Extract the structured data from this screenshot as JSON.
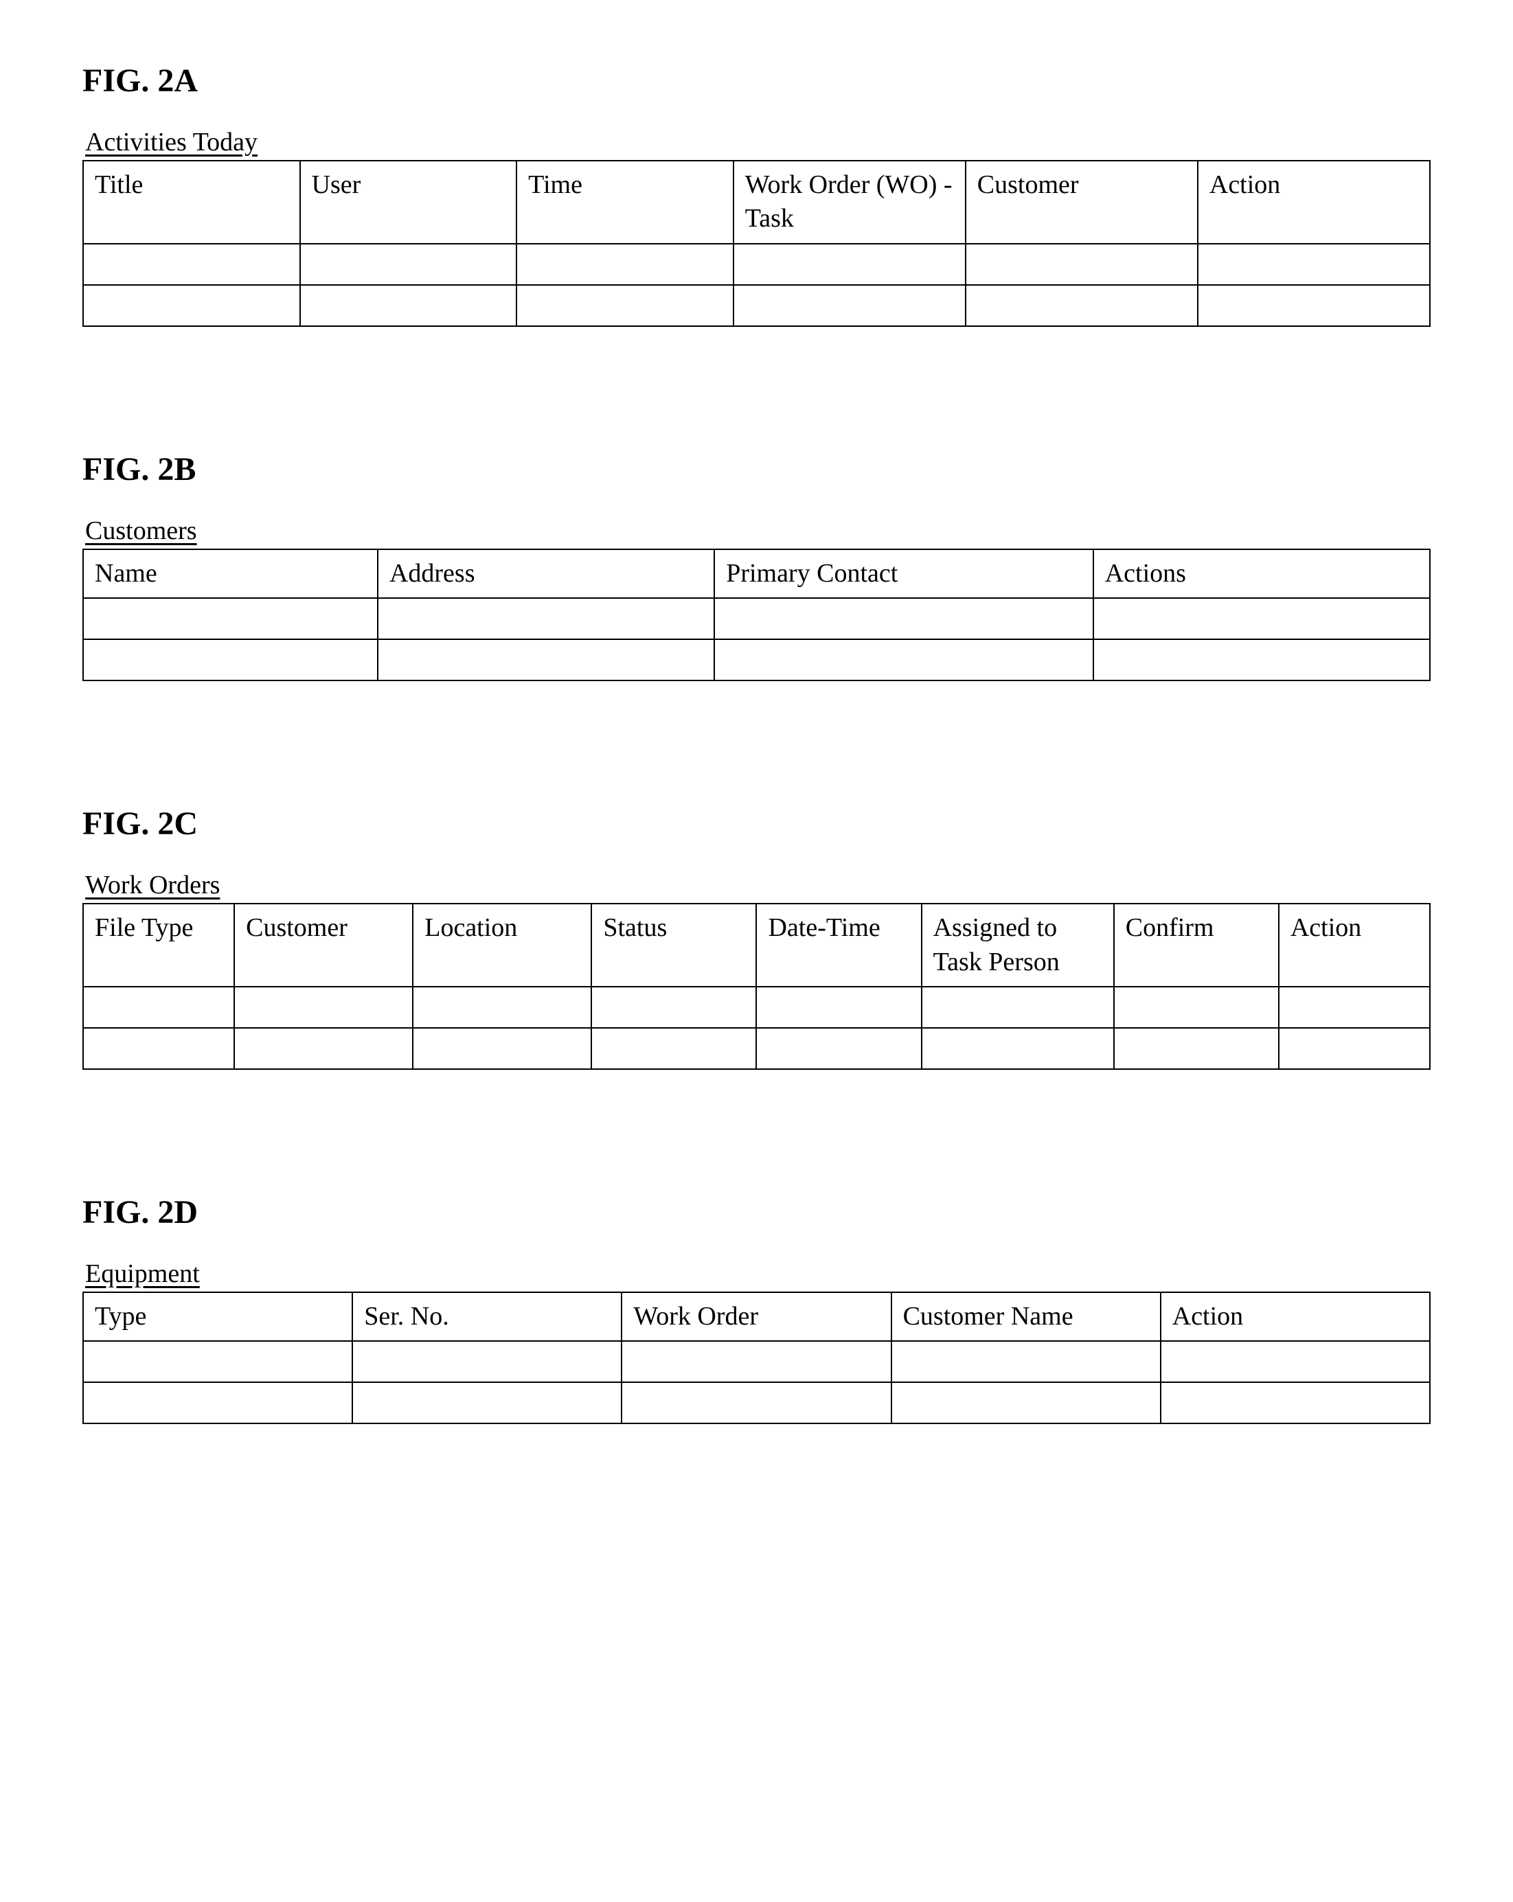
{
  "figures": {
    "a": {
      "label": "FIG. 2A",
      "title": "Activities Today",
      "headers": [
        "Title",
        "User",
        "Time",
        "Work Order (WO) - Task",
        "Customer",
        "Action"
      ]
    },
    "b": {
      "label": "FIG. 2B",
      "title": "Customers",
      "headers": [
        "Name",
        "Address",
        "Primary Contact",
        "Actions"
      ]
    },
    "c": {
      "label": "FIG. 2C",
      "title": "Work Orders",
      "headers": [
        "File Type",
        "Customer",
        "Location",
        "Status",
        "Date-Time",
        "Assigned to Task Person",
        "Confirm",
        "Action"
      ]
    },
    "d": {
      "label": "FIG. 2D",
      "title": "Equipment",
      "headers": [
        "Type",
        "Ser. No.",
        "Work Order",
        "Customer Name",
        "Action"
      ]
    }
  }
}
